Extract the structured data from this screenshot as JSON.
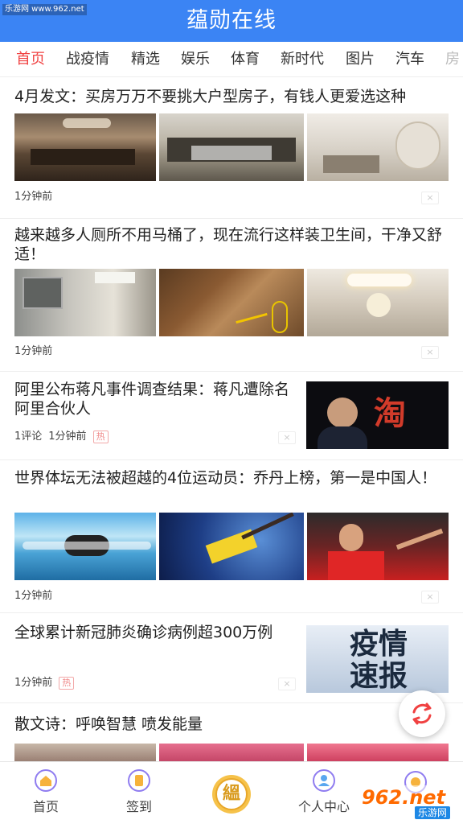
{
  "watermark_top": "乐游网 www.962.net",
  "app_title": "蕴勋在线",
  "tabs": [
    "首页",
    "战疫情",
    "精选",
    "娱乐",
    "体育",
    "新时代",
    "图片",
    "汽车",
    "房"
  ],
  "articles": [
    {
      "title": "4月发文：买房万万不要挑大户型房子，有钱人更爱选这种",
      "time": "1分钟前"
    },
    {
      "title": "越来越多人厕所不用马桶了，现在流行这样装卫生间，干净又舒适！",
      "time": "1分钟前"
    },
    {
      "title": "阿里公布蒋凡事件调查结果：蒋凡遭除名阿里合伙人",
      "comments": "1评论",
      "time": "1分钟前",
      "badge": "热",
      "thumb_text": "淘"
    },
    {
      "title": "世界体坛无法被超越的4位运动员：乔丹上榜，第一是中国人！",
      "time": "1分钟前"
    },
    {
      "title": "全球累计新冠肺炎确诊病例超300万例",
      "time": "1分钟前",
      "badge": "热",
      "thumb_text": "疫情\n速报"
    },
    {
      "title": "散文诗：呼唤智慧 喷发能量"
    }
  ],
  "dismiss_glyph": "×",
  "bottom_nav": [
    {
      "label": "首页",
      "icon": "home-icon"
    },
    {
      "label": "签到",
      "icon": "checkin-icon"
    },
    {
      "label": "个人中心",
      "icon": "user-icon"
    }
  ],
  "center_button_glyph": "縕",
  "watermark_bottom": {
    "line1": "962.net",
    "line2": "乐游网"
  },
  "colors": {
    "primary": "#3b84f4",
    "active_tab": "#f04141",
    "hot": "#f08a8a"
  }
}
